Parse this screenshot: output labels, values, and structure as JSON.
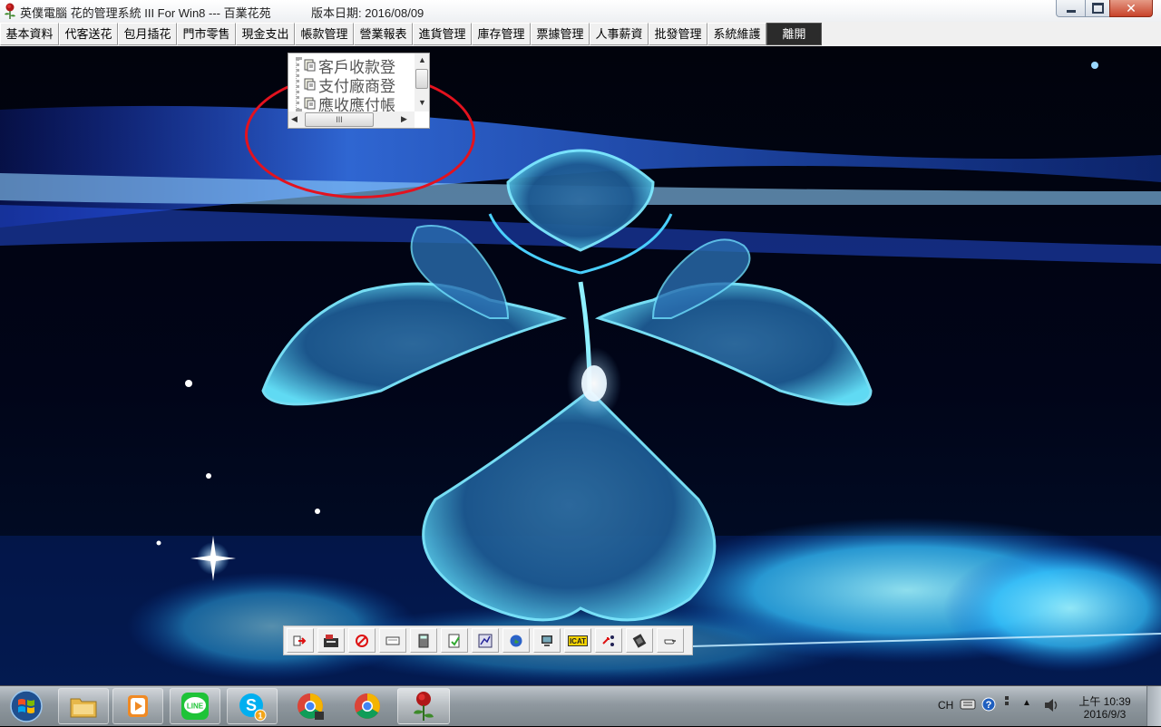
{
  "window": {
    "title": "英僕電腦 花的管理系統 III For Win8 --- 百業花苑",
    "version_label": "版本日期: 2016/08/09"
  },
  "menu": {
    "items": [
      "基本資料",
      "代客送花",
      "包月插花",
      "門市零售",
      "現金支出",
      "帳款管理",
      "營業報表",
      "進貨管理",
      "庫存管理",
      "票據管理",
      "人事薪資",
      "批發管理",
      "系統維護",
      "離開"
    ]
  },
  "popup": {
    "items": [
      "客戶收款登",
      "支付廠商登",
      "應收應付帳"
    ],
    "hscroll_thumb_text": "III"
  },
  "toolbar": {
    "icons": [
      "exit-arrow-icon",
      "cash-register-icon",
      "stop-icon",
      "card-icon",
      "calculator-icon",
      "notepad-icon",
      "chart-icon",
      "globe-icon",
      "monitor-icon",
      "icat-icon",
      "shuffle-icon",
      "keyboard-icon",
      "pointing-hand-icon"
    ],
    "icat_label": "ICAT"
  },
  "taskbar": {
    "apps": [
      "file-explorer-icon",
      "media-player-icon",
      "line-icon",
      "skype-icon",
      "chrome-icon",
      "chrome-icon",
      "rose-app-icon"
    ],
    "line_label": "LINE",
    "skype_badge": "1",
    "input_language": "CH",
    "clock_time": "上午 10:39",
    "clock_date": "2016/9/3"
  },
  "colors": {
    "highlight_circle": "#e4121e",
    "flower_glow": "#4fd6ff",
    "wallpaper_base": "#000814"
  }
}
